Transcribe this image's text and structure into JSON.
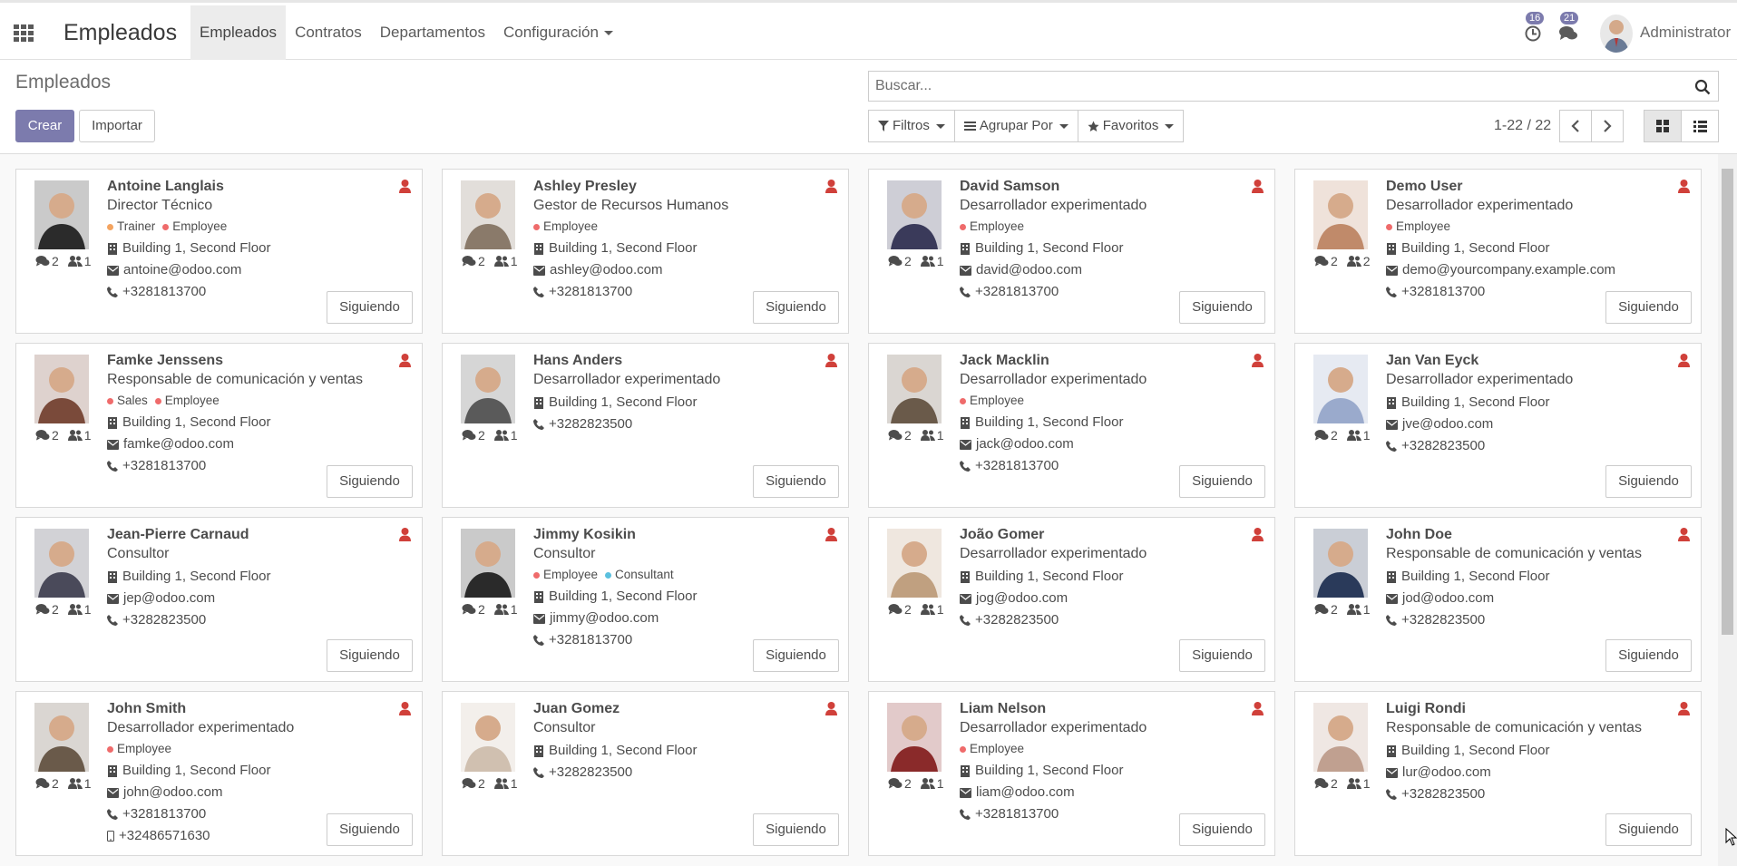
{
  "app": {
    "title": "Empleados",
    "menu": [
      "Empleados",
      "Contratos",
      "Departamentos",
      "Configuración"
    ],
    "activities_count": "16",
    "messages_count": "21",
    "user": "Administrator"
  },
  "control": {
    "breadcrumb": "Empleados",
    "create_label": "Crear",
    "import_label": "Importar",
    "search_placeholder": "Buscar...",
    "filters_label": "Filtros",
    "group_by_label": "Agrupar Por",
    "favorites_label": "Favoritos",
    "pager": "1-22 / 22"
  },
  "colors": {
    "accent": "#7c7bad",
    "follower_icon": "#d0403a",
    "tag_red": "#ef6b6b",
    "tag_orange": "#f4a460",
    "tag_blue": "#5bc0de"
  },
  "follow_label": "Siguiendo",
  "employees": [
    {
      "name": "Antoine Langlais",
      "job": "Director Técnico",
      "tags": [
        {
          "label": "Trainer",
          "color": "#f4a460"
        },
        {
          "label": "Employee",
          "color": "#ef6b6b"
        }
      ],
      "address": "Building 1, Second Floor",
      "email": "antoine@odoo.com",
      "phone": "+3281813700",
      "mobile": "",
      "messages": "2",
      "followers": "1"
    },
    {
      "name": "Ashley Presley",
      "job": "Gestor de Recursos Humanos",
      "tags": [
        {
          "label": "Employee",
          "color": "#ef6b6b"
        }
      ],
      "address": "Building 1, Second Floor",
      "email": "ashley@odoo.com",
      "phone": "+3281813700",
      "mobile": "",
      "messages": "2",
      "followers": "1"
    },
    {
      "name": "David Samson",
      "job": "Desarrollador experimentado",
      "tags": [
        {
          "label": "Employee",
          "color": "#ef6b6b"
        }
      ],
      "address": "Building 1, Second Floor",
      "email": "david@odoo.com",
      "phone": "+3281813700",
      "mobile": "",
      "messages": "2",
      "followers": "1"
    },
    {
      "name": "Demo User",
      "job": "Desarrollador experimentado",
      "tags": [
        {
          "label": "Employee",
          "color": "#ef6b6b"
        }
      ],
      "address": "Building 1, Second Floor",
      "email": "demo@yourcompany.example.com",
      "phone": "+3281813700",
      "mobile": "",
      "messages": "2",
      "followers": "2"
    },
    {
      "name": "Famke Jenssens",
      "job": "Responsable de comunicación y ventas",
      "tags": [
        {
          "label": "Sales",
          "color": "#ef6b6b"
        },
        {
          "label": "Employee",
          "color": "#ef6b6b"
        }
      ],
      "address": "Building 1, Second Floor",
      "email": "famke@odoo.com",
      "phone": "+3281813700",
      "mobile": "",
      "messages": "2",
      "followers": "1"
    },
    {
      "name": "Hans Anders",
      "job": "Desarrollador experimentado",
      "tags": [],
      "address": "Building 1, Second Floor",
      "email": "",
      "phone": "+3282823500",
      "mobile": "",
      "messages": "2",
      "followers": "1"
    },
    {
      "name": "Jack Macklin",
      "job": "Desarrollador experimentado",
      "tags": [
        {
          "label": "Employee",
          "color": "#ef6b6b"
        }
      ],
      "address": "Building 1, Second Floor",
      "email": "jack@odoo.com",
      "phone": "+3281813700",
      "mobile": "",
      "messages": "2",
      "followers": "1"
    },
    {
      "name": "Jan Van Eyck",
      "job": "Desarrollador experimentado",
      "tags": [],
      "address": "Building 1, Second Floor",
      "email": "jve@odoo.com",
      "phone": "+3282823500",
      "mobile": "",
      "messages": "2",
      "followers": "1"
    },
    {
      "name": "Jean-Pierre Carnaud",
      "job": "Consultor",
      "tags": [],
      "address": "Building 1, Second Floor",
      "email": "jep@odoo.com",
      "phone": "+3282823500",
      "mobile": "",
      "messages": "2",
      "followers": "1"
    },
    {
      "name": "Jimmy Kosikin",
      "job": "Consultor",
      "tags": [
        {
          "label": "Employee",
          "color": "#ef6b6b"
        },
        {
          "label": "Consultant",
          "color": "#5bc0de"
        }
      ],
      "address": "Building 1, Second Floor",
      "email": "jimmy@odoo.com",
      "phone": "+3281813700",
      "mobile": "",
      "messages": "2",
      "followers": "1"
    },
    {
      "name": "João Gomer",
      "job": "Desarrollador experimentado",
      "tags": [],
      "address": "Building 1, Second Floor",
      "email": "jog@odoo.com",
      "phone": "+3282823500",
      "mobile": "",
      "messages": "2",
      "followers": "1"
    },
    {
      "name": "John Doe",
      "job": "Responsable de comunicación y ventas",
      "tags": [],
      "address": "Building 1, Second Floor",
      "email": "jod@odoo.com",
      "phone": "+3282823500",
      "mobile": "",
      "messages": "2",
      "followers": "1"
    },
    {
      "name": "John Smith",
      "job": "Desarrollador experimentado",
      "tags": [
        {
          "label": "Employee",
          "color": "#ef6b6b"
        }
      ],
      "address": "Building 1, Second Floor",
      "email": "john@odoo.com",
      "phone": "+3281813700",
      "mobile": "+32486571630",
      "messages": "2",
      "followers": "1"
    },
    {
      "name": "Juan Gomez",
      "job": "Consultor",
      "tags": [],
      "address": "Building 1, Second Floor",
      "email": "",
      "phone": "+3282823500",
      "mobile": "",
      "messages": "2",
      "followers": "1"
    },
    {
      "name": "Liam Nelson",
      "job": "Desarrollador experimentado",
      "tags": [
        {
          "label": "Employee",
          "color": "#ef6b6b"
        }
      ],
      "address": "Building 1, Second Floor",
      "email": "liam@odoo.com",
      "phone": "+3281813700",
      "mobile": "",
      "messages": "2",
      "followers": "1"
    },
    {
      "name": "Luigi Rondi",
      "job": "Responsable de comunicación y ventas",
      "tags": [],
      "address": "Building 1, Second Floor",
      "email": "lur@odoo.com",
      "phone": "+3282823500",
      "mobile": "",
      "messages": "2",
      "followers": "1"
    }
  ]
}
